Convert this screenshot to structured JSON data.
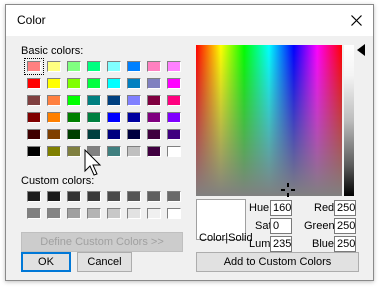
{
  "window": {
    "title": "Color"
  },
  "labels": {
    "basic_colors": "Basic colors:",
    "custom_colors": "Custom colors:",
    "color_solid": "Color|Solid",
    "hue": "Hue:",
    "sat": "Sat:",
    "lum": "Lum:",
    "red": "Red:",
    "green": "Green:",
    "blue": "Blue:"
  },
  "fields": {
    "hue": "160",
    "sat": "0",
    "lum": "235",
    "red": "250",
    "green": "250",
    "blue": "250"
  },
  "buttons": {
    "define_custom": "Define Custom Colors >>",
    "ok": "OK",
    "cancel": "Cancel",
    "add_custom": "Add to Custom Colors"
  },
  "basic_colors": [
    [
      "#ff8080",
      "#ffff80",
      "#80ff80",
      "#00ff80",
      "#80ffff",
      "#0080ff",
      "#ff80c0",
      "#ff80ff"
    ],
    [
      "#ff0000",
      "#ffff00",
      "#80ff00",
      "#00ff40",
      "#00ffff",
      "#0080c0",
      "#8080c0",
      "#ff00ff"
    ],
    [
      "#804040",
      "#ff8040",
      "#00ff00",
      "#008080",
      "#004080",
      "#8080ff",
      "#800040",
      "#ff0080"
    ],
    [
      "#800000",
      "#ff8000",
      "#008000",
      "#008040",
      "#0000ff",
      "#0000a0",
      "#800080",
      "#8000ff"
    ],
    [
      "#400000",
      "#804000",
      "#004000",
      "#004040",
      "#000080",
      "#000040",
      "#400040",
      "#400080"
    ],
    [
      "#000000",
      "#808000",
      "#808040",
      "#808080",
      "#408080",
      "#c0c0c0",
      "#400040",
      "#ffffff"
    ]
  ],
  "custom_colors": [
    [
      "#1c1c1c",
      "#1a1a1a",
      "#333333",
      "#3a3a3a",
      "#4a4a4a",
      "#555555",
      "#5f5f5f",
      "#6a6a6a"
    ],
    [
      "#808080",
      "#858585",
      "#a0a0a0",
      "#b4b4b4",
      "#c8c8c8",
      "#e2e2e2",
      "#f0f0f0",
      "#ffffff"
    ]
  ],
  "colors": {
    "accent": "#0078d7",
    "window_bg": "#f0f0f0"
  }
}
